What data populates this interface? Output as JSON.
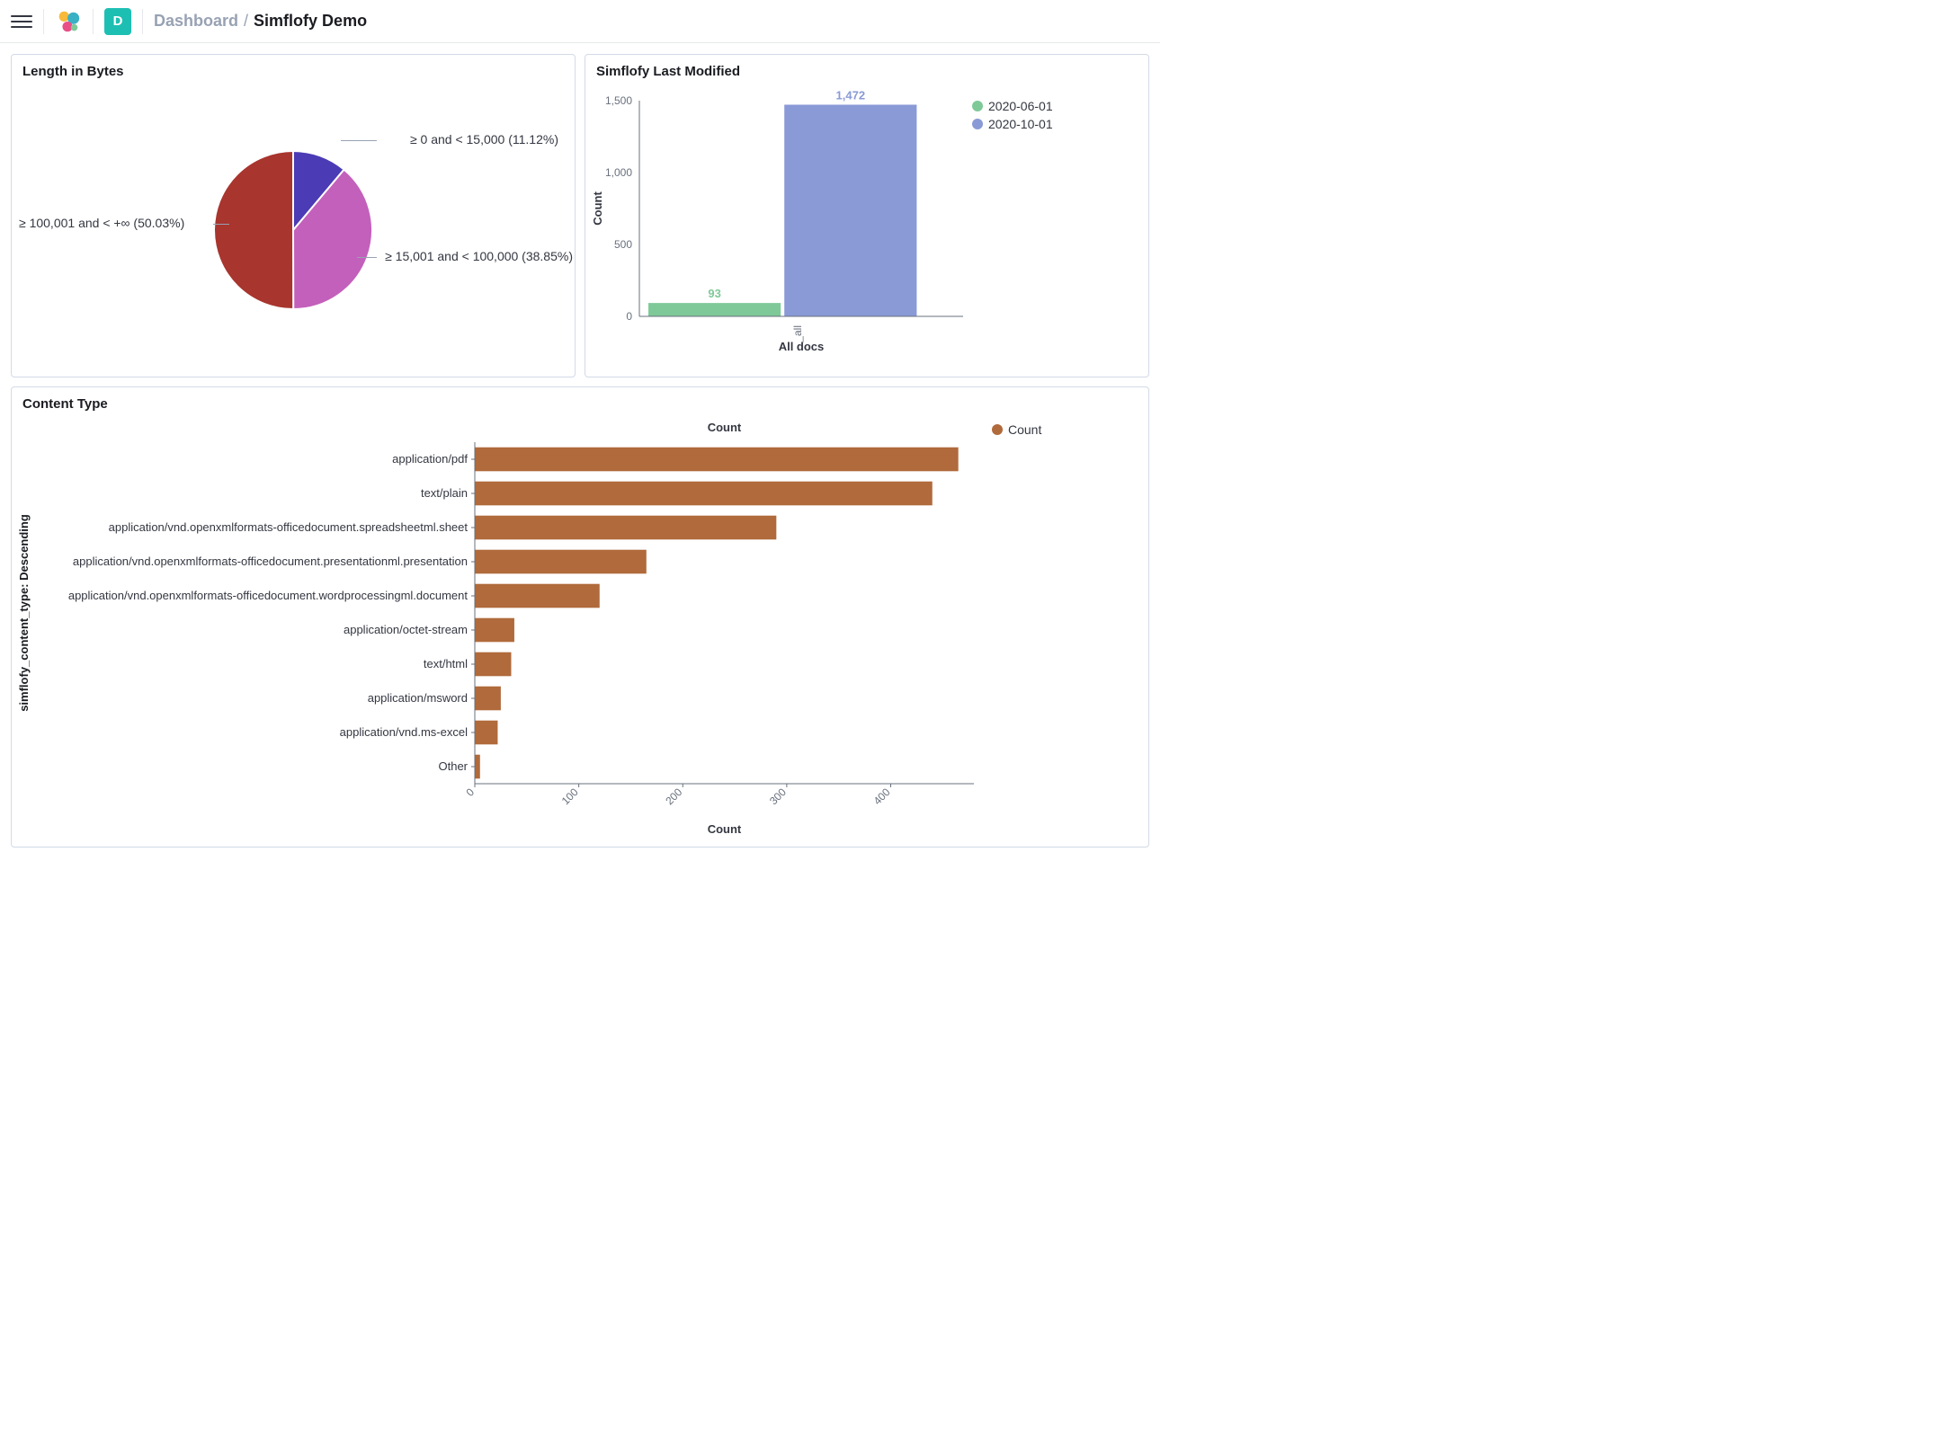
{
  "header": {
    "space_initial": "D",
    "breadcrumb_root": "Dashboard",
    "breadcrumb_current": "Simflofy Demo"
  },
  "panels": {
    "pie": {
      "title": "Length in Bytes"
    },
    "bars": {
      "title": "Simflofy Last Modified"
    },
    "hbar": {
      "title": "Content Type"
    }
  },
  "chart_data": [
    {
      "id": "length_in_bytes",
      "type": "pie",
      "title": "Length in Bytes",
      "slices": [
        {
          "label": "≥ 0 and < 15,000",
          "pct": 11.12,
          "display": "≥ 0 and < 15,000 (11.12%)",
          "color": "#4b3bb5"
        },
        {
          "label": "≥ 15,001 and < 100,000",
          "pct": 38.85,
          "display": "≥ 15,001 and < 100,000 (38.85%)",
          "color": "#c360bb"
        },
        {
          "label": "≥ 100,001 and < +∞",
          "pct": 50.03,
          "display": "≥ 100,001 and < +∞ (50.03%)",
          "color": "#a8352e"
        }
      ]
    },
    {
      "id": "last_modified",
      "type": "bar",
      "title": "Simflofy Last Modified",
      "xlabel": "All docs",
      "ylabel": "Count",
      "ylim": [
        0,
        1500
      ],
      "yticks": [
        0,
        500,
        1000,
        1500
      ],
      "categories": [
        "_all"
      ],
      "series": [
        {
          "name": "2020-06-01",
          "values": [
            93
          ],
          "color": "#7fc998"
        },
        {
          "name": "2020-10-01",
          "values": [
            1472
          ],
          "color": "#8a9ad6"
        }
      ]
    },
    {
      "id": "content_type",
      "type": "bar",
      "orientation": "horizontal",
      "title": "Content Type",
      "xlabel": "Count",
      "xlabel_top": "Count",
      "ylabel": "simflofy_content_type: Descending",
      "legend": [
        {
          "name": "Count",
          "color": "#b06a3b"
        }
      ],
      "xlim": [
        0,
        480
      ],
      "xticks": [
        0,
        100,
        200,
        300,
        400
      ],
      "categories": [
        "application/pdf",
        "text/plain",
        "application/vnd.openxmlformats-officedocument.spreadsheetml.sheet",
        "application/vnd.openxmlformats-officedocument.presentationml.presentation",
        "application/vnd.openxmlformats-officedocument.wordprocessingml.document",
        "application/octet-stream",
        "text/html",
        "application/msword",
        "application/vnd.ms-excel",
        "Other"
      ],
      "values": [
        465,
        440,
        290,
        165,
        120,
        38,
        35,
        25,
        22,
        5
      ],
      "color": "#b06a3b"
    }
  ]
}
